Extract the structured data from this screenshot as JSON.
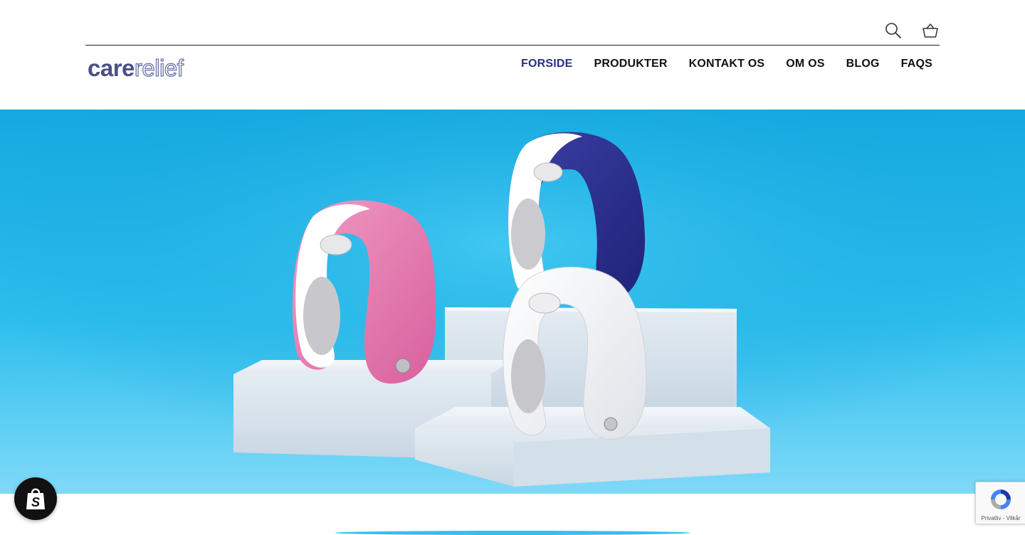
{
  "header": {
    "logo": {
      "part1": "care",
      "part2": "relief"
    },
    "icons": {
      "search": "search-icon",
      "cart": "basket-icon"
    },
    "nav": [
      {
        "label": "FORSIDE",
        "active": true
      },
      {
        "label": "PRODUKTER",
        "active": false
      },
      {
        "label": "KONTAKT OS",
        "active": false
      },
      {
        "label": "OM OS",
        "active": false
      },
      {
        "label": "BLOG",
        "active": false
      },
      {
        "label": "FAQS",
        "active": false
      }
    ]
  },
  "hero": {
    "background_color": "#1fb3e6",
    "products": [
      {
        "color_name": "pink",
        "color": "#e27db0"
      },
      {
        "color_name": "navy",
        "color": "#2a2f8c"
      },
      {
        "color_name": "white",
        "color": "#f2f2f4"
      }
    ]
  },
  "colors": {
    "accent": "#2b2e8a",
    "logo": "#4a4f86"
  },
  "widgets": {
    "shopify_icon": "shopify-bag-icon",
    "recaptcha": {
      "icon": "recaptcha-icon",
      "privacy": "Privatliv",
      "separator": "-",
      "terms": "Vilkår"
    }
  }
}
